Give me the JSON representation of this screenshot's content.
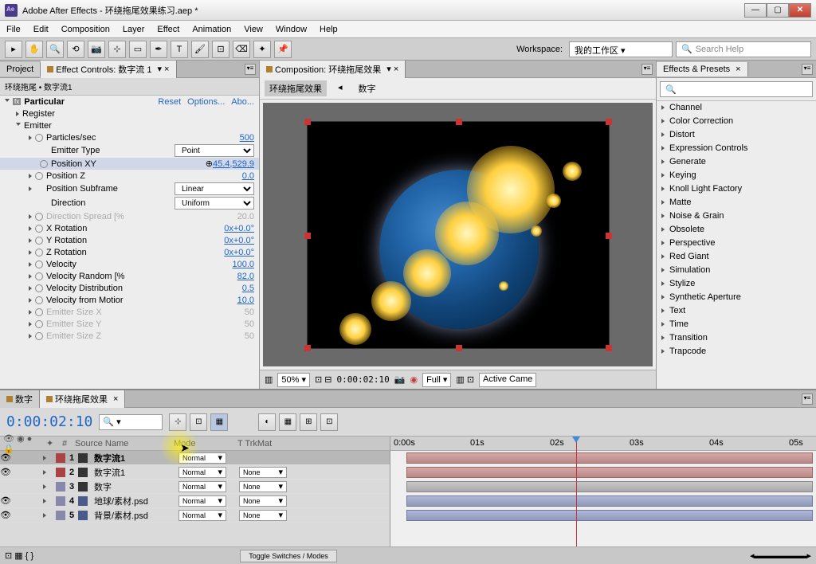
{
  "titlebar": {
    "title": "Adobe After Effects - 环绕拖尾效果练习.aep *"
  },
  "menu": [
    "File",
    "Edit",
    "Composition",
    "Layer",
    "Effect",
    "Animation",
    "View",
    "Window",
    "Help"
  ],
  "toolbar": {
    "workspace_label": "Workspace:",
    "workspace_value": "我的工作区",
    "search_placeholder": "Search Help"
  },
  "leftPanel": {
    "tabs": {
      "project": "Project",
      "effectControls": "Effect Controls: 数字流 1"
    },
    "header": "环绕拖尾 • 数字流1",
    "effect": {
      "name": "Particular",
      "reset": "Reset",
      "options": "Options...",
      "about": "Abo..."
    },
    "groups": {
      "register": "Register",
      "emitter": "Emitter"
    },
    "props": {
      "particlesSec": {
        "label": "Particles/sec",
        "value": "500"
      },
      "emitterType": {
        "label": "Emitter Type",
        "value": "Point"
      },
      "positionXY": {
        "label": "Position XY",
        "value": "45.4,529.9"
      },
      "positionZ": {
        "label": "Position Z",
        "value": "0.0"
      },
      "posSubframe": {
        "label": "Position Subframe",
        "value": "Linear"
      },
      "direction": {
        "label": "Direction",
        "value": "Uniform"
      },
      "dirSpread": {
        "label": "Direction Spread [%",
        "value": "20.0"
      },
      "xRotation": {
        "label": "X Rotation",
        "value": "0x+0.0°"
      },
      "yRotation": {
        "label": "Y Rotation",
        "value": "0x+0.0°"
      },
      "zRotation": {
        "label": "Z Rotation",
        "value": "0x+0.0°"
      },
      "velocity": {
        "label": "Velocity",
        "value": "100.0"
      },
      "velRandom": {
        "label": "Velocity Random [%",
        "value": "82.0"
      },
      "velDist": {
        "label": "Velocity Distribution",
        "value": "0.5"
      },
      "velMotion": {
        "label": "Velocity from Motior",
        "value": "10.0"
      },
      "sizeX": {
        "label": "Emitter Size X",
        "value": "50"
      },
      "sizeY": {
        "label": "Emitter Size Y",
        "value": "50"
      },
      "sizeZ": {
        "label": "Emitter Size Z",
        "value": "50"
      }
    }
  },
  "centerPanel": {
    "tab": "Composition: 环绕拖尾效果",
    "subtabs": [
      "环绕拖尾效果",
      "数字"
    ],
    "controls": {
      "zoom": "50%",
      "time": "0:00:02:10",
      "res": "Full",
      "view": "Active Came"
    }
  },
  "rightPanel": {
    "tab": "Effects & Presets",
    "items": [
      "Channel",
      "Color Correction",
      "Distort",
      "Expression Controls",
      "Generate",
      "Keying",
      "Knoll Light Factory",
      "Matte",
      "Noise & Grain",
      "Obsolete",
      "Perspective",
      "Red Giant",
      "Simulation",
      "Stylize",
      "Synthetic Aperture",
      "Text",
      "Time",
      "Transition",
      "Trapcode"
    ]
  },
  "timeline": {
    "tabs": [
      "数字",
      "环绕拖尾效果"
    ],
    "time": "0:00:02:10",
    "colhead": {
      "idx": "#",
      "src": "Source Name",
      "mode": "Mode",
      "trkmat": "T  TrkMat"
    },
    "layers": [
      {
        "num": "1",
        "color": "#aa4444",
        "name": "数字流1",
        "mode": "Normal",
        "trk": "",
        "vis": true,
        "sel": true,
        "psd": false
      },
      {
        "num": "2",
        "color": "#aa4444",
        "name": "数字流1",
        "mode": "Normal",
        "trk": "None",
        "vis": true,
        "sel": false,
        "psd": false
      },
      {
        "num": "3",
        "color": "#8888aa",
        "name": "数字",
        "mode": "Normal",
        "trk": "None",
        "vis": false,
        "sel": false,
        "psd": false
      },
      {
        "num": "4",
        "color": "#8888aa",
        "name": "地球/素材.psd",
        "mode": "Normal",
        "trk": "None",
        "vis": true,
        "sel": false,
        "psd": true
      },
      {
        "num": "5",
        "color": "#8888aa",
        "name": "背景/素材.psd",
        "mode": "Normal",
        "trk": "None",
        "vis": true,
        "sel": false,
        "psd": true
      }
    ],
    "ruler": [
      "0:00s",
      "01s",
      "02s",
      "03s",
      "04s",
      "05s"
    ],
    "toggle": "Toggle Switches / Modes"
  }
}
